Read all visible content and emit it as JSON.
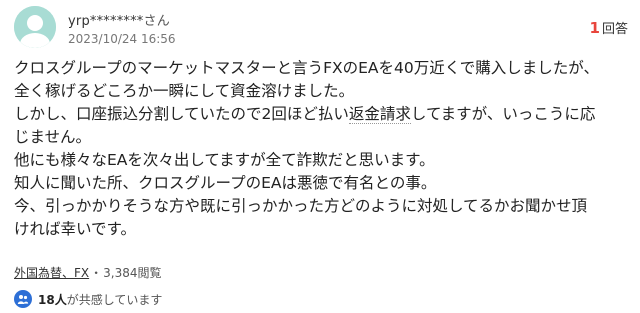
{
  "question": {
    "username": "yrp********",
    "username_suffix": "さん",
    "timestamp": "2023/10/24 16:56",
    "answer_count": "1",
    "answer_label": "回答",
    "body_lines": [
      "クロスグループのマーケットマスターと言うFXのEAを40万近くで購入しましたが、",
      "全く稼げるどころか一瞬にして資金溶けました。",
      "しかし、口座振込分割していたので2回ほど払い返金請求してますが、いっこうに応",
      "じません。",
      "他にも様々なEAを次々出してますが全て詐欺だと思います。",
      "知人に聞いた所、クロスグループのEAは悪徳で有名との事。",
      "今、引っかかりそうな方や既に引っかかった方どのように対処してるかお聞かせ頂",
      "ければ幸いです。"
    ],
    "category": "外国為替、FX",
    "separator": "・",
    "views": "3,384閲覧",
    "empathy_count": "18人",
    "empathy_label": "が共感しています"
  },
  "colors": {
    "avatar_bg": "#a8dcd4",
    "answer_count": "#e8453c",
    "empathy_icon": "#2d6fd6"
  },
  "icons": [
    "user-avatar-icon",
    "empathy-badge-icon"
  ]
}
